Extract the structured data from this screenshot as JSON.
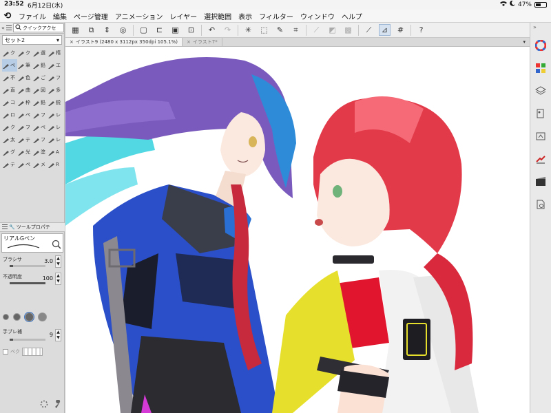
{
  "status_bar": {
    "time": "23:52",
    "date": "6月12日(水)",
    "battery_percent": "47%",
    "battery_level": 0.47
  },
  "menu": {
    "items": [
      "ファイル",
      "編集",
      "ページ管理",
      "アニメーション",
      "レイヤー",
      "選択範囲",
      "表示",
      "フィルター",
      "ウィンドウ",
      "ヘルプ"
    ]
  },
  "left_panel": {
    "tab_label": "クイックアクセ",
    "set_label": "セット2",
    "tools": [
      {
        "label": "ク",
        "icon": "cursor-icon"
      },
      {
        "label": "ク",
        "icon": "lasso-icon"
      },
      {
        "label": "選",
        "icon": "rect-select-icon"
      },
      {
        "label": "楕",
        "icon": "ellipse-icon"
      },
      {
        "label": "ペ",
        "icon": "pen-icon"
      },
      {
        "label": "筆",
        "icon": "brush-icon"
      },
      {
        "label": "鉛",
        "icon": "pencil-icon"
      },
      {
        "label": "エ",
        "icon": "airbrush-icon"
      },
      {
        "label": "不",
        "icon": "eraser-icon"
      },
      {
        "label": "色",
        "icon": "fill-icon"
      },
      {
        "label": "ご",
        "icon": "blend-icon"
      },
      {
        "label": "フ",
        "icon": "gradient-icon"
      },
      {
        "label": "直",
        "icon": "line-icon"
      },
      {
        "label": "曲",
        "icon": "curve-icon"
      },
      {
        "label": "図",
        "icon": "shape-icon"
      },
      {
        "label": "多",
        "icon": "polygon-icon"
      },
      {
        "label": "コ",
        "icon": "frame-icon"
      },
      {
        "label": "枠",
        "icon": "panel-icon"
      },
      {
        "label": "鉛",
        "icon": "pencil2-icon"
      },
      {
        "label": "鋭",
        "icon": "sharp-icon"
      },
      {
        "label": "ロ",
        "icon": "rotate-icon"
      },
      {
        "label": "ペ",
        "icon": "paste-icon"
      },
      {
        "label": "フ",
        "icon": "filter-icon"
      },
      {
        "label": "レ",
        "icon": "layer-move-icon"
      },
      {
        "label": "ク",
        "icon": "eyedropper-icon"
      },
      {
        "label": "フ",
        "icon": "funnel-icon"
      },
      {
        "label": "ペ",
        "icon": "bucket-icon"
      },
      {
        "label": "レ",
        "icon": "layer-icon"
      },
      {
        "label": "太",
        "icon": "thick-icon"
      },
      {
        "label": "テ",
        "icon": "text-icon"
      },
      {
        "label": "フ",
        "icon": "balloon-icon"
      },
      {
        "label": "レ",
        "icon": "ruler-icon"
      },
      {
        "label": "グ",
        "icon": "grad-icon"
      },
      {
        "label": "光",
        "icon": "light-icon"
      },
      {
        "label": "塗",
        "icon": "paint-icon"
      },
      {
        "label": "A",
        "icon": "letter-a-icon"
      },
      {
        "label": "テ",
        "icon": "text2-icon"
      },
      {
        "label": "ペ",
        "icon": "pen2-icon"
      },
      {
        "label": "メ",
        "icon": "mesh-icon"
      },
      {
        "label": "R",
        "icon": "color-icon"
      }
    ],
    "subtool_header": "ツールプロパテ",
    "subtool_name": "リアルGペン",
    "brush_size_label": "ブラシサ",
    "brush_size_value": "3.0",
    "opacity_label": "不透明度",
    "opacity_value": "100",
    "stabilization_label": "手ブレ補",
    "stabilization_value": "9",
    "vector_label": "ベク"
  },
  "toolbar": {
    "buttons": [
      "grid-menu-icon",
      "layer-view-icon",
      "updown-icon",
      "swirl-icon",
      "new-icon",
      "open-icon",
      "save-icon",
      "export-icon",
      "undo-icon",
      "redo-icon",
      "spinner-icon",
      "transform-icon",
      "pen-pressure-icon",
      "crop-icon",
      "diagonal-disabled-icon",
      "clear-disabled-icon",
      "fill-disabled-icon",
      "ruler-snap-icon",
      "special-ruler-icon",
      "grid-snap-icon",
      "help-icon"
    ]
  },
  "document_tabs": [
    {
      "label": "イラスト9 (2480 x 3112px 350dpi 105.1%)",
      "active": true
    },
    {
      "label": "イラスト7*",
      "active": false
    }
  ],
  "right_dock": [
    "color-wheel-icon",
    "color-set-icon",
    "layers-icon",
    "palette-icon",
    "sub-view-icon",
    "item-icon",
    "animation-icon",
    "search-icon"
  ],
  "colors": {
    "hair_purple": "#7a5bbd",
    "hair_cyan": "#3fd4e0",
    "jacket_blue": "#2a4fc9",
    "hair_red": "#e33a4a",
    "jacket_yellow": "#e6e02c",
    "top_red": "#e2152f"
  }
}
